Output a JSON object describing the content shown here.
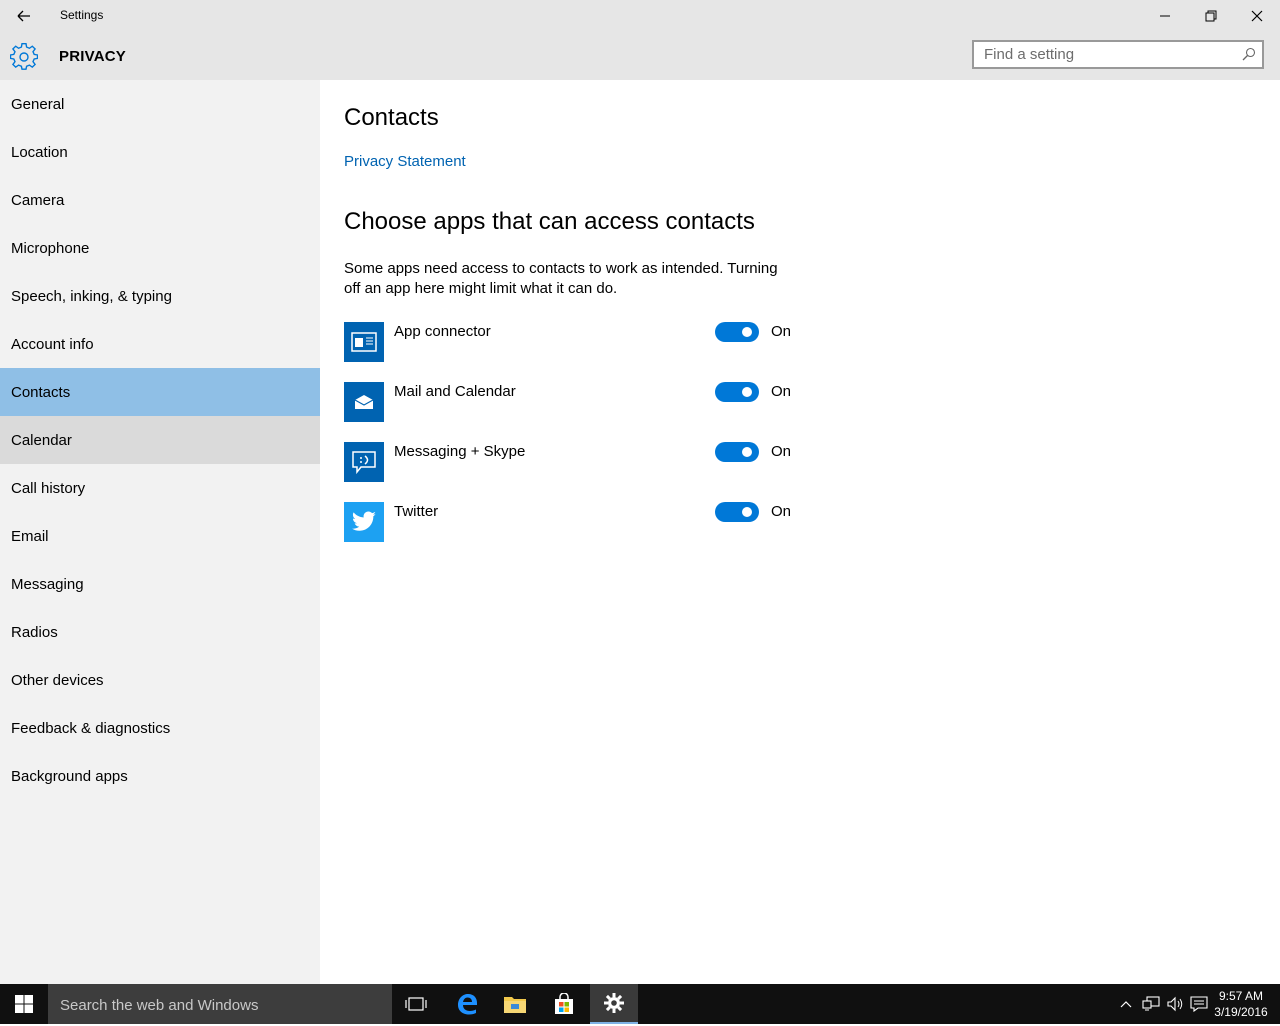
{
  "window": {
    "title": "Settings",
    "section": "PRIVACY",
    "search_placeholder": "Find a setting"
  },
  "sidebar": {
    "items": [
      {
        "label": "General"
      },
      {
        "label": "Location"
      },
      {
        "label": "Camera"
      },
      {
        "label": "Microphone"
      },
      {
        "label": "Speech, inking, & typing"
      },
      {
        "label": "Account info"
      },
      {
        "label": "Contacts",
        "state": "selected"
      },
      {
        "label": "Calendar",
        "state": "hover"
      },
      {
        "label": "Call history"
      },
      {
        "label": "Email"
      },
      {
        "label": "Messaging"
      },
      {
        "label": "Radios"
      },
      {
        "label": "Other devices"
      },
      {
        "label": "Feedback & diagnostics"
      },
      {
        "label": "Background apps"
      }
    ]
  },
  "main": {
    "title": "Contacts",
    "privacy_link": "Privacy Statement",
    "subtitle": "Choose apps that can access contacts",
    "description": "Some apps need access to contacts to work as intended. Turning off an app here might limit what it can do.",
    "apps": [
      {
        "name": "App connector",
        "icon": "app-connector-icon",
        "toggle": "On",
        "on": true
      },
      {
        "name": "Mail and Calendar",
        "icon": "mail-icon",
        "toggle": "On",
        "on": true
      },
      {
        "name": "Messaging + Skype",
        "icon": "messaging-icon",
        "toggle": "On",
        "on": true
      },
      {
        "name": "Twitter",
        "icon": "twitter-icon",
        "toggle": "On",
        "on": true
      }
    ]
  },
  "taskbar": {
    "search_placeholder": "Search the web and Windows",
    "time": "9:57 AM",
    "date": "3/19/2016"
  },
  "colors": {
    "accent": "#0078d7",
    "selected_nav": "#8fbfe6",
    "link": "#0063b1",
    "twitter": "#1da1f2"
  }
}
